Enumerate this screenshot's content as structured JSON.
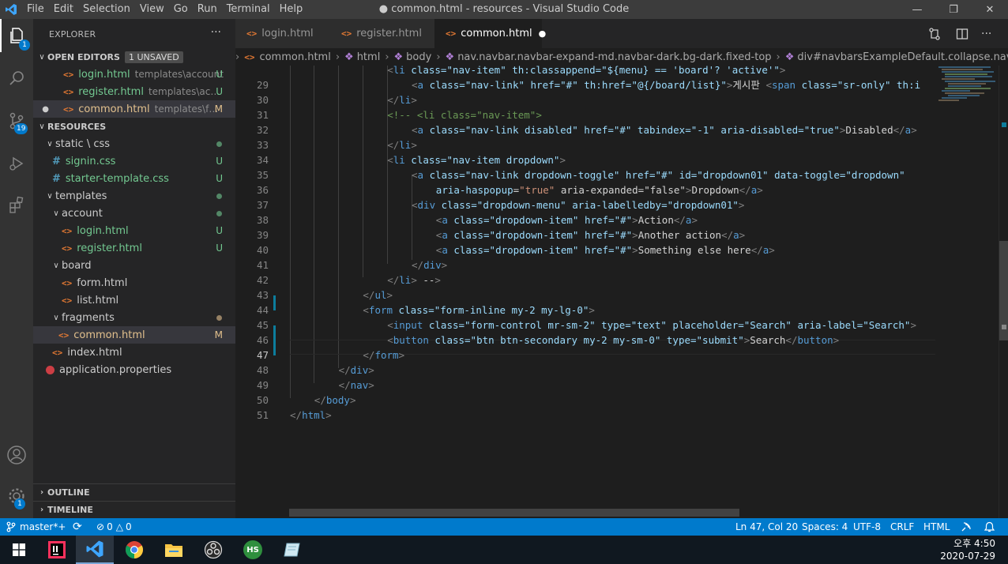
{
  "window": {
    "title": "● common.html - resources - Visual Studio Code",
    "min_icon": "minimize-icon",
    "max_icon": "restore-icon",
    "close_icon": "close-icon"
  },
  "menu": [
    "File",
    "Edit",
    "Selection",
    "View",
    "Go",
    "Run",
    "Terminal",
    "Help"
  ],
  "activity": [
    {
      "icon": "explorer-icon",
      "badge": "1"
    },
    {
      "icon": "search-icon",
      "badge": ""
    },
    {
      "icon": "source-control-icon",
      "badge": "19"
    },
    {
      "icon": "run-debug-icon",
      "badge": ""
    },
    {
      "icon": "extensions-icon",
      "badge": ""
    },
    {
      "icon": "account-icon",
      "badge": ""
    },
    {
      "icon": "settings-gear-icon",
      "badge": "1"
    }
  ],
  "sidebar": {
    "title": "EXPLORER",
    "more": "···",
    "open_editors": {
      "label": "OPEN EDITORS",
      "badge": "1 UNSAVED",
      "items": [
        {
          "name": "login.html",
          "path": "templates\\account",
          "status": "U"
        },
        {
          "name": "register.html",
          "path": "templates\\acco...",
          "status": "U"
        },
        {
          "name": "common.html",
          "path": "templates\\fra...",
          "status": "M"
        }
      ]
    },
    "root": "RESOURCES",
    "tree": [
      {
        "label": "static \\ css",
        "type": "folder"
      },
      {
        "label": "signin.css",
        "type": "css",
        "status": "U"
      },
      {
        "label": "starter-template.css",
        "type": "css",
        "status": "U"
      },
      {
        "label": "templates",
        "type": "folder"
      },
      {
        "label": "account",
        "type": "folder"
      },
      {
        "label": "login.html",
        "type": "html",
        "status": "U"
      },
      {
        "label": "register.html",
        "type": "html",
        "status": "U"
      },
      {
        "label": "board",
        "type": "folder"
      },
      {
        "label": "form.html",
        "type": "html"
      },
      {
        "label": "list.html",
        "type": "html"
      },
      {
        "label": "fragments",
        "type": "folder"
      },
      {
        "label": "common.html",
        "type": "html",
        "status": "M"
      },
      {
        "label": "index.html",
        "type": "html"
      },
      {
        "label": "application.properties",
        "type": "props"
      }
    ],
    "outline": "OUTLINE",
    "timeline": "TIMELINE"
  },
  "tabs": [
    {
      "label": "login.html"
    },
    {
      "label": "register.html"
    },
    {
      "label": "common.html",
      "dirty": "●"
    }
  ],
  "breadcrumb": [
    "common.html",
    "html",
    "body",
    "nav.navbar.navbar-expand-md.navbar-dark.bg-dark.fixed-top",
    "div#navbarsExampleDefault.collapse.navbar-collapse"
  ],
  "editor": {
    "lines": [
      {
        "n": "",
        "code": "<li class=\"nav-item\" th:classappend=\"${menu} == 'board'? 'active'\">"
      },
      {
        "n": "29",
        "code": "<a class=\"nav-link\" href=\"#\" th:href=\"@{/board/list}\">게시판 <span class=\"sr-only\" th:i"
      },
      {
        "n": "30",
        "code": "</li>"
      },
      {
        "n": "31",
        "code": "<!-- <li class=\"nav-item\">"
      },
      {
        "n": "32",
        "code": "<a class=\"nav-link disabled\" href=\"#\" tabindex=\"-1\" aria-disabled=\"true\">Disabled</a>"
      },
      {
        "n": "33",
        "code": "</li>"
      },
      {
        "n": "34",
        "code": "<li class=\"nav-item dropdown\">"
      },
      {
        "n": "35",
        "code": "<a class=\"nav-link dropdown-toggle\" href=\"#\" id=\"dropdown01\" data-toggle=\"dropdown\""
      },
      {
        "n": "36",
        "code": "aria-haspopup=\"true\" aria-expanded=\"false\">Dropdown</a>"
      },
      {
        "n": "37",
        "code": "<div class=\"dropdown-menu\" aria-labelledby=\"dropdown01\">"
      },
      {
        "n": "38",
        "code": "<a class=\"dropdown-item\" href=\"#\">Action</a>"
      },
      {
        "n": "39",
        "code": "<a class=\"dropdown-item\" href=\"#\">Another action</a>"
      },
      {
        "n": "40",
        "code": "<a class=\"dropdown-item\" href=\"#\">Something else here</a>"
      },
      {
        "n": "41",
        "code": "</div>"
      },
      {
        "n": "42",
        "code": "</li> -->"
      },
      {
        "n": "43",
        "code": "</ul>"
      },
      {
        "n": "44",
        "code": "<form class=\"form-inline my-2 my-lg-0\">"
      },
      {
        "n": "45",
        "code": "<input class=\"form-control mr-sm-2\" type=\"text\" placeholder=\"Search\" aria-label=\"Search\">"
      },
      {
        "n": "46",
        "code": "<button class=\"btn btn-secondary my-2 my-sm-0\" type=\"submit\">Search</button>"
      },
      {
        "n": "47",
        "code": "</form>"
      },
      {
        "n": "48",
        "code": "</div>"
      },
      {
        "n": "49",
        "code": "</nav>"
      },
      {
        "n": "50",
        "code": "</body>"
      },
      {
        "n": "51",
        "code": "</html>"
      }
    ]
  },
  "status": {
    "branch": "master*+",
    "sync_icon": "sync-icon",
    "errors": "0",
    "warnings": "0",
    "position": "Ln 47, Col 20",
    "spaces": "Spaces: 4",
    "encoding": "UTF-8",
    "eol": "CRLF",
    "language": "HTML",
    "feedback_icon": "feedback-icon",
    "bell_icon": "bell-icon"
  },
  "taskbar": {
    "apps": [
      "windows-start-icon",
      "intellij-icon",
      "vscode-icon",
      "chrome-icon",
      "file-explorer-icon",
      "obs-icon",
      "hs-app-icon",
      "notes-app-icon"
    ],
    "hs_label": "HS",
    "time": "오후 4:50",
    "date": "2020-07-29"
  }
}
